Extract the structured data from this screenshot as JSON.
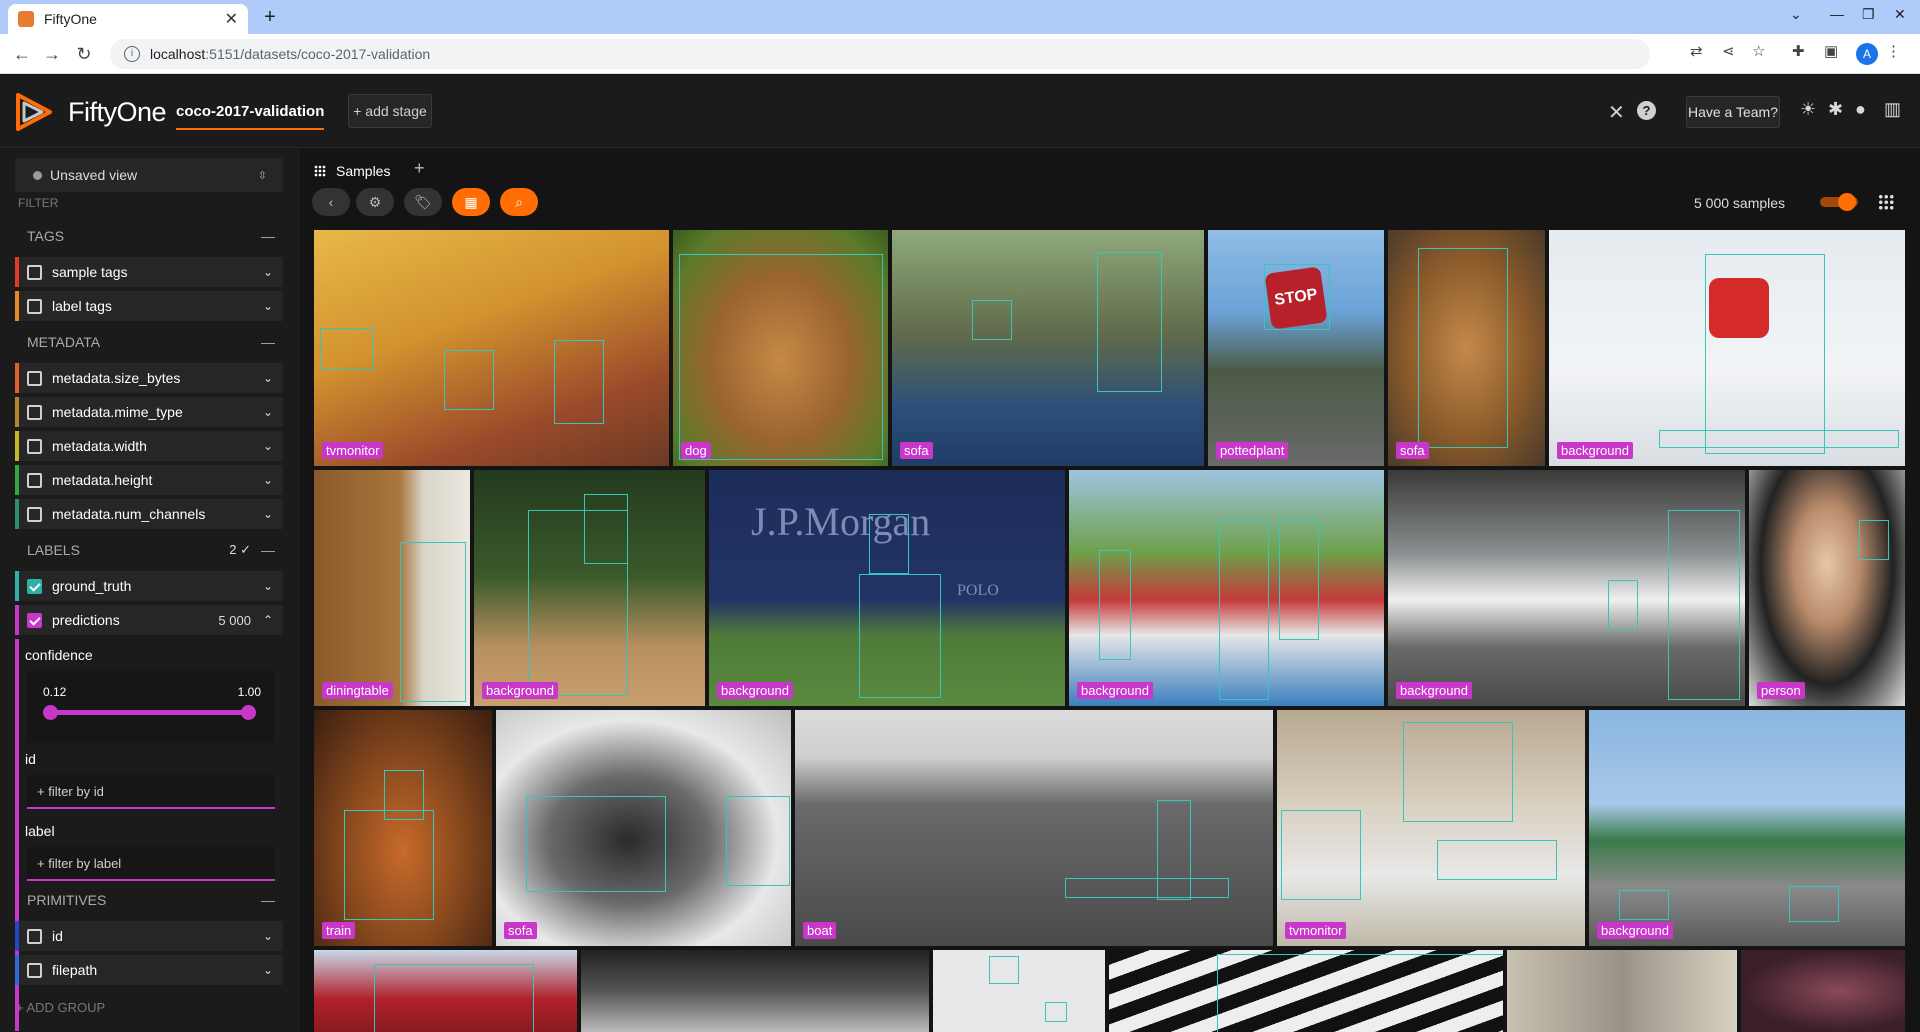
{
  "browser": {
    "tab_title": "FiftyOne",
    "url_host": "localhost",
    "url_rest": ":5151/datasets/coco-2017-validation",
    "profile_initial": "A"
  },
  "header": {
    "brand": "FiftyOne",
    "dataset": "coco-2017-validation",
    "add_stage": "+ add stage",
    "team_button": "Have a Team?",
    "accent": "#ff6d04"
  },
  "sidebar": {
    "view_selector": "Unsaved view",
    "filter_label": "FILTER",
    "sections": {
      "tags": "TAGS",
      "metadata": "METADATA",
      "labels": "LABELS",
      "labels_count": "2 ✓",
      "primitives": "PRIMITIVES"
    },
    "tags": [
      "sample tags",
      "label tags"
    ],
    "metadata": [
      "metadata.size_bytes",
      "metadata.mime_type",
      "metadata.width",
      "metadata.height",
      "metadata.num_channels"
    ],
    "labels": {
      "ground_truth": "ground_truth",
      "predictions": "predictions",
      "predictions_count": "5 000",
      "confidence_label": "confidence",
      "confidence_min": "0.12",
      "confidence_max": "1.00",
      "id_label": "id",
      "id_placeholder": "+ filter by id",
      "label_label": "label",
      "label_placeholder": "+ filter by label"
    },
    "primitives": [
      "id",
      "filepath"
    ],
    "add_group": "+ ADD GROUP"
  },
  "main": {
    "panel_tab": "Samples",
    "samples_count": "5 000 samples"
  },
  "grid_labels": {
    "r1": [
      "tvmonitor",
      "dog",
      "sofa",
      "pottedplant",
      "sofa",
      "background"
    ],
    "r2": [
      "diningtable",
      "background",
      "background",
      "background",
      "background",
      "person"
    ],
    "r3": [
      "train",
      "sofa",
      "boat",
      "tvmonitor",
      "background"
    ]
  },
  "misc_text": {
    "jpmorgan": "J.P.Morgan",
    "polo": "POLO",
    "stop": "STOP"
  }
}
